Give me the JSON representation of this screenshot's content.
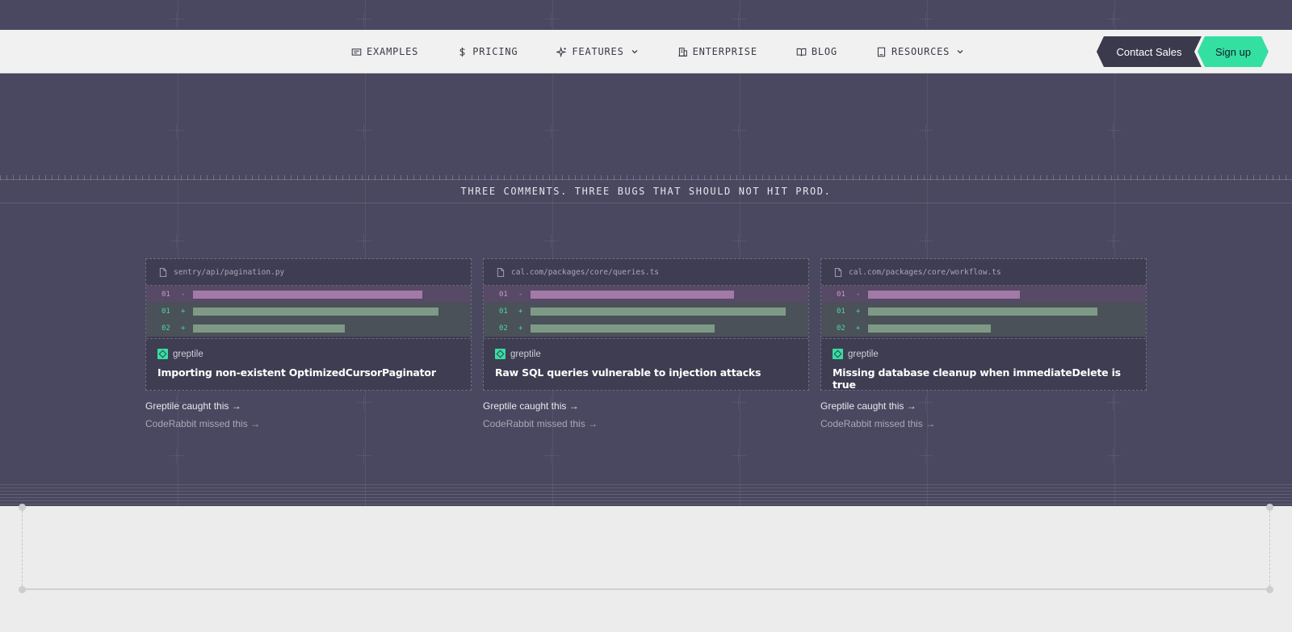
{
  "nav": {
    "items": [
      {
        "label": "EXAMPLES",
        "icon": "examples-icon",
        "dropdown": false
      },
      {
        "label": "PRICING",
        "icon": "dollar-icon",
        "dropdown": false
      },
      {
        "label": "FEATURES",
        "icon": "sparkle-icon",
        "dropdown": true
      },
      {
        "label": "ENTERPRISE",
        "icon": "building-icon",
        "dropdown": false
      },
      {
        "label": "BLOG",
        "icon": "book-icon",
        "dropdown": false
      },
      {
        "label": "RESOURCES",
        "icon": "document-icon",
        "dropdown": true
      }
    ],
    "contact_label": "Contact Sales",
    "signup_label": "Sign up"
  },
  "headline": "THREE COMMENTS. THREE BUGS THAT SHOULD NOT HIT PROD.",
  "cards": [
    {
      "file": "sentry/api/pagination.py",
      "lines": [
        {
          "num": "01",
          "sign": "-",
          "fill": 0.71
        },
        {
          "num": "01",
          "sign": "+",
          "fill": 0.76
        },
        {
          "num": "02",
          "sign": "+",
          "fill": 0.47
        }
      ],
      "bot": "greptile",
      "title": "Importing non-existent OptimizedCursorPaginator",
      "caught": "Greptile caught this",
      "missed": "CodeRabbit missed this"
    },
    {
      "file": "cal.com/packages/core/queries.ts",
      "lines": [
        {
          "num": "01",
          "sign": "-",
          "fill": 0.63
        },
        {
          "num": "01",
          "sign": "+",
          "fill": 0.79
        },
        {
          "num": "02",
          "sign": "+",
          "fill": 0.57
        }
      ],
      "bot": "greptile",
      "title": "Raw SQL queries vulnerable to injection attacks",
      "caught": "Greptile caught this",
      "missed": "CodeRabbit missed this"
    },
    {
      "file": "cal.com/packages/core/workflow.ts",
      "lines": [
        {
          "num": "01",
          "sign": "-",
          "fill": 0.47
        },
        {
          "num": "01",
          "sign": "+",
          "fill": 0.71
        },
        {
          "num": "02",
          "sign": "+",
          "fill": 0.38
        }
      ],
      "bot": "greptile",
      "title": "Missing database cleanup when immediateDelete is true",
      "caught": "Greptile caught this",
      "missed": "CodeRabbit missed this"
    }
  ],
  "colors": {
    "accent": "#34e0a1",
    "dark_bg": "#4a4860",
    "removed": "#a37aa7",
    "added": "#7e9a86"
  }
}
